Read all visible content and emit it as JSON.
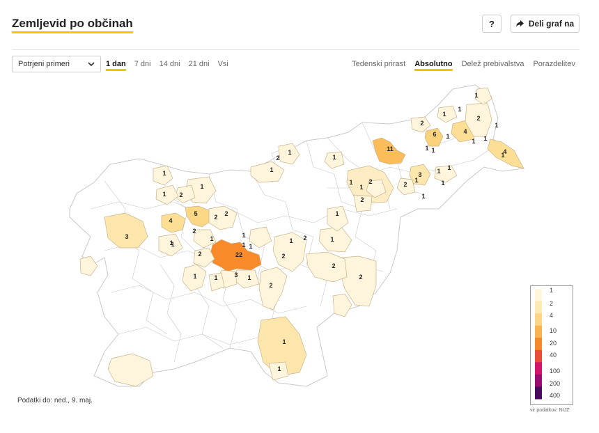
{
  "header": {
    "title": "Zemljevid po občinah",
    "help_label": "?",
    "share_label": "Deli graf na"
  },
  "controls": {
    "select_value": "Potrjeni primeri",
    "periods": [
      "1 dan",
      "7 dni",
      "14 dni",
      "21 dni",
      "Vsi"
    ],
    "active_period": "1 dan",
    "views": [
      "Tedenski prirast",
      "Absolutno",
      "Delež prebivalstva",
      "Porazdelitev"
    ],
    "active_view": "Absolutno"
  },
  "map": {
    "municipalities_with_cases": [
      {
        "value": 22,
        "color": "#f88a2a"
      },
      {
        "value": 11,
        "color": "#fbbc5a"
      },
      {
        "value": 6,
        "color": "#fbd27c"
      },
      {
        "value": 5,
        "color": "#fcd886"
      },
      {
        "value": 4,
        "color": "#fcde94"
      },
      {
        "value": 4,
        "color": "#fcde94"
      },
      {
        "value": 4,
        "color": "#fcde94"
      },
      {
        "value": 3,
        "color": "#fde6ac"
      },
      {
        "value": 3,
        "color": "#fde6ac"
      },
      {
        "value": 3,
        "color": "#fde6ac"
      },
      {
        "value": 2,
        "color": "#feedc4"
      },
      {
        "value": 1,
        "color": "#fff4dc"
      }
    ],
    "labels": [
      "1",
      "1",
      "1",
      "2",
      "6",
      "4",
      "1",
      "2",
      "1",
      "1",
      "11",
      "1",
      "1",
      "1",
      "1",
      "4",
      "1",
      "1",
      "2",
      "1",
      "3",
      "1",
      "1",
      "2",
      "1",
      "2",
      "1",
      "1",
      "2",
      "1",
      "1",
      "1",
      "4",
      "5",
      "2",
      "2",
      "2",
      "3",
      "1",
      "1",
      "1",
      "1",
      "1",
      "1",
      "1",
      "2",
      "1",
      "1",
      "22",
      "2",
      "2",
      "2",
      "2",
      "1",
      "1",
      "2",
      "1",
      "2",
      "1",
      "3",
      "1",
      "1",
      "1"
    ]
  },
  "legend": {
    "ticks": [
      "1",
      "2",
      "4",
      "10",
      "20",
      "40",
      "100",
      "200",
      "400"
    ],
    "colors": [
      "#fff6dc",
      "#fde9b4",
      "#fbd688",
      "#f8b453",
      "#f48a2a",
      "#ea4c3a",
      "#d0156a",
      "#9a0b6f",
      "#4a0b5e"
    ],
    "source": "vir podatkov: NIJZ"
  },
  "footer": {
    "date_text": "Podatki do: ned., 9. maj."
  }
}
